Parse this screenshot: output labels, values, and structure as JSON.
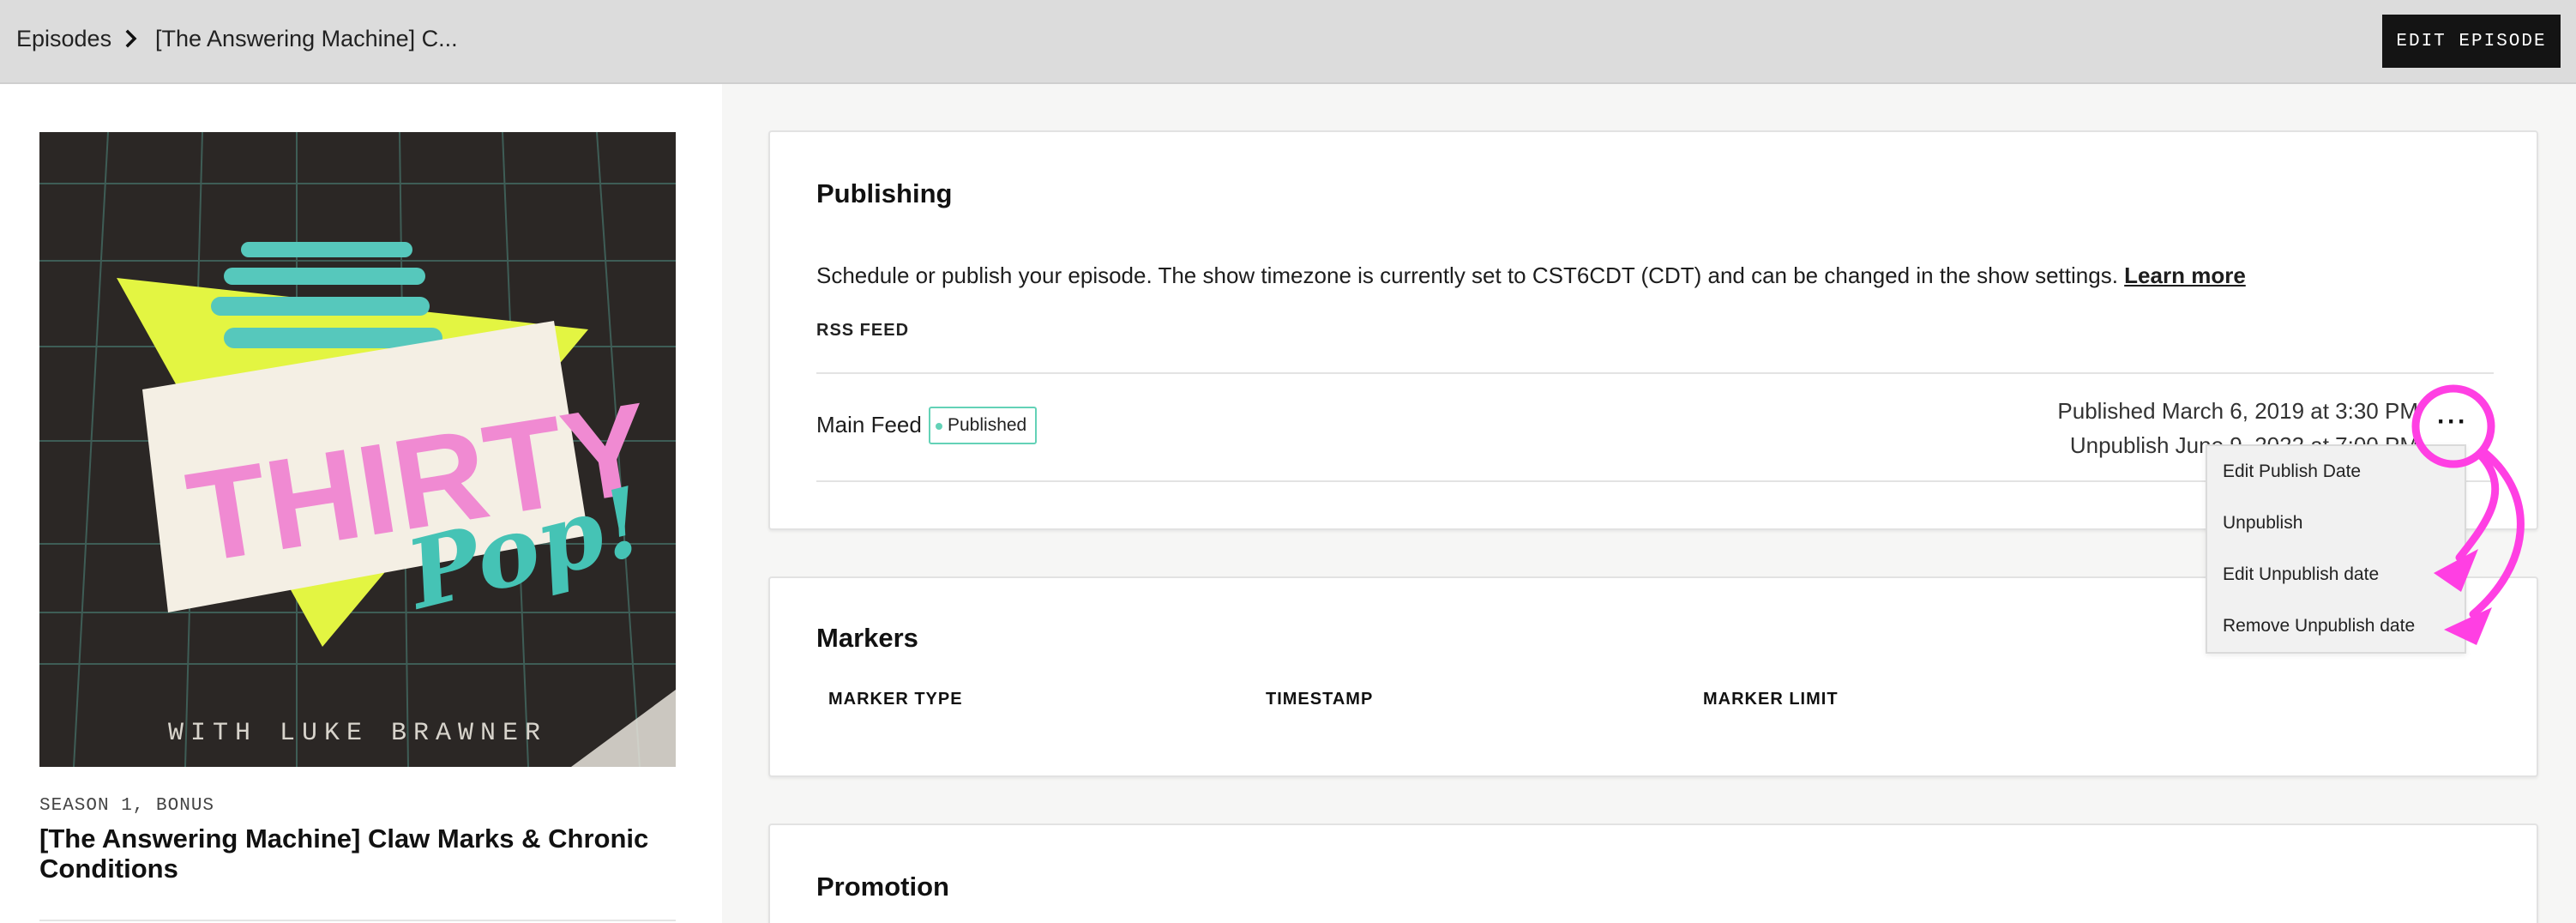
{
  "header": {
    "breadcrumb_root": "Episodes",
    "breadcrumb_current": "[The Answering Machine] C...",
    "edit_button": "EDIT EPISODE"
  },
  "episode": {
    "season_label": "SEASON 1, BONUS",
    "title": "[The Answering Machine] Claw Marks & Chronic Conditions",
    "cover_text_main": "THIRTY",
    "cover_text_script": "Pop!",
    "cover_text_credit": "WITH LUKE BRAWNER"
  },
  "publishing": {
    "title": "Publishing",
    "description": "Schedule or publish your episode. The show timezone is currently set to CST6CDT (CDT) and can be changed in the show settings.",
    "learn_more": "Learn more",
    "rss_label": "RSS FEED",
    "feed": {
      "name": "Main Feed",
      "status": "Published",
      "published": "Published March 6, 2019 at 3:30 PM",
      "unpublish": "Unpublish June 9, 2022 at 7:00 PM"
    },
    "menu": [
      "Edit Publish Date",
      "Unpublish",
      "Edit Unpublish date",
      "Remove Unpublish date"
    ]
  },
  "markers": {
    "title": "Markers",
    "columns": [
      "MARKER TYPE",
      "TIMESTAMP",
      "MARKER LIMIT"
    ]
  },
  "promotion": {
    "title": "Promotion"
  },
  "colors": {
    "annotation": "#ff3fe3",
    "published_badge": "#63d2b7",
    "topbar": "#dcdcdc"
  }
}
